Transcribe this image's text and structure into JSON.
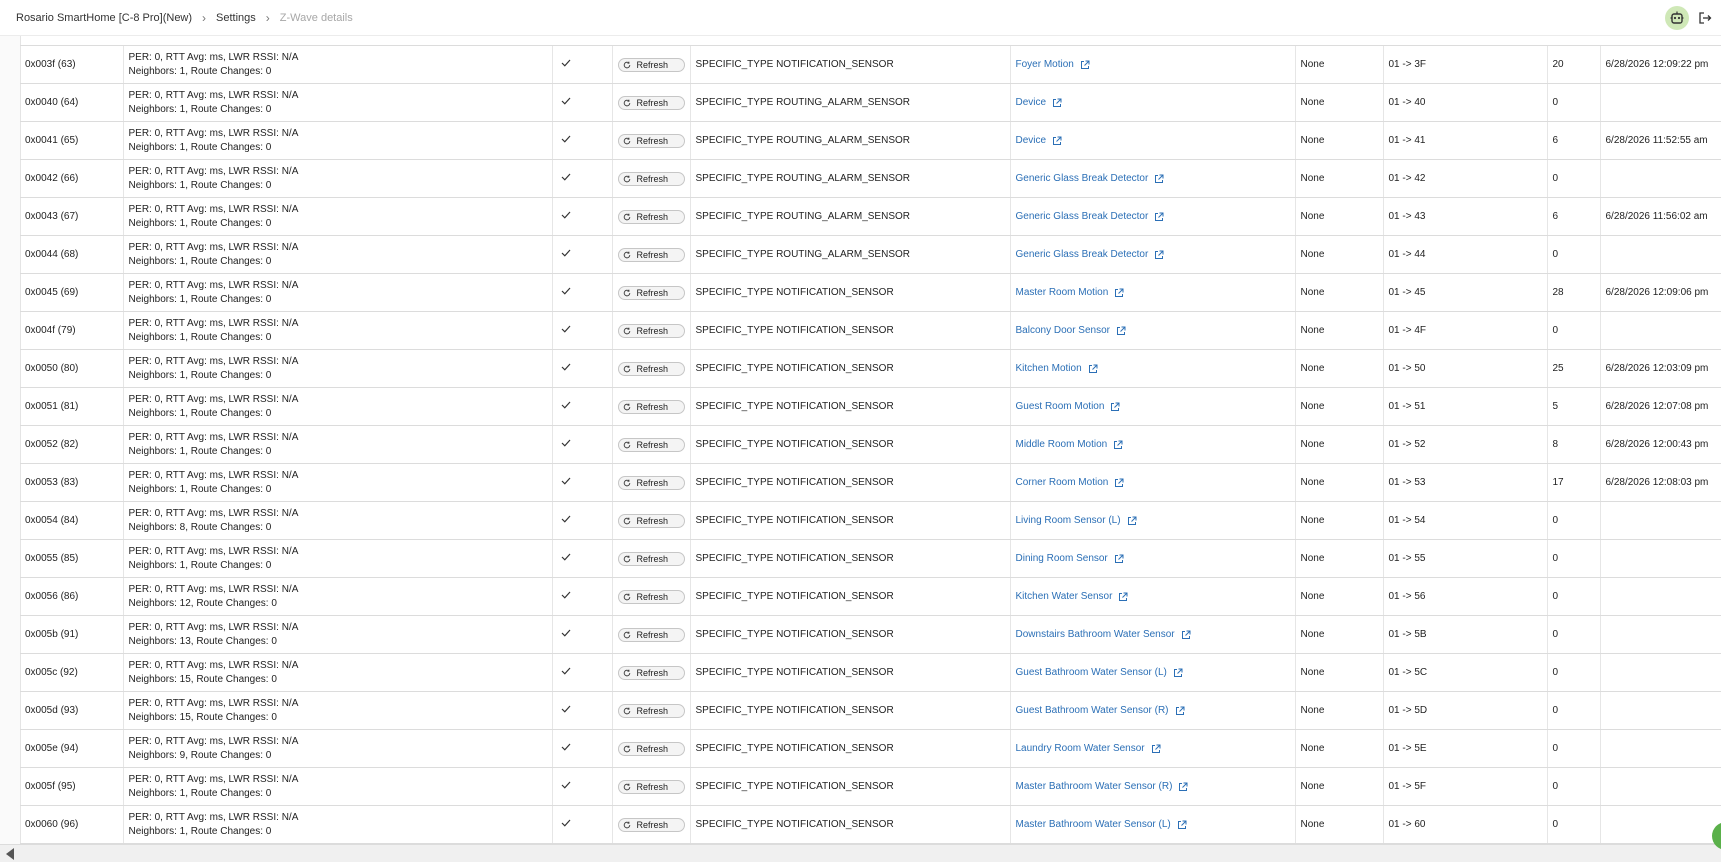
{
  "breadcrumb": {
    "hub": "Rosario SmartHome [C-8 Pro](New)",
    "settings": "Settings",
    "current": "Z-Wave details"
  },
  "icons": {
    "robot": "robot-icon",
    "logout": "logout-icon",
    "refresh": "refresh-icon",
    "external": "external-link-icon",
    "check": "check-icon"
  },
  "colors": {
    "link": "#2b6fb6",
    "robot_bg": "#cfe8b7",
    "fab": "#5ab04a"
  },
  "refresh_label": "Refresh",
  "rows": [
    {
      "id": "0x003f (63)",
      "stats": "PER: 0, RTT Avg: ms, LWR RSSI: N/A",
      "neighbors": "Neighbors: 1, Route Changes: 0",
      "type": "SPECIFIC_TYPE NOTIFICATION_SENSOR",
      "device": "Foyer Motion",
      "security": "None",
      "route": "01 -> 3F",
      "count": "20",
      "time": "6/28/2026 12:09:22 pm"
    },
    {
      "id": "0x0040 (64)",
      "stats": "PER: 0, RTT Avg: ms, LWR RSSI: N/A",
      "neighbors": "Neighbors: 1, Route Changes: 0",
      "type": "SPECIFIC_TYPE ROUTING_ALARM_SENSOR",
      "device": "Device",
      "security": "None",
      "route": "01 -> 40",
      "count": "0",
      "time": ""
    },
    {
      "id": "0x0041 (65)",
      "stats": "PER: 0, RTT Avg: ms, LWR RSSI: N/A",
      "neighbors": "Neighbors: 1, Route Changes: 0",
      "type": "SPECIFIC_TYPE ROUTING_ALARM_SENSOR",
      "device": "Device",
      "security": "None",
      "route": "01 -> 41",
      "count": "6",
      "time": "6/28/2026 11:52:55 am"
    },
    {
      "id": "0x0042 (66)",
      "stats": "PER: 0, RTT Avg: ms, LWR RSSI: N/A",
      "neighbors": "Neighbors: 1, Route Changes: 0",
      "type": "SPECIFIC_TYPE ROUTING_ALARM_SENSOR",
      "device": "Generic Glass Break Detector",
      "security": "None",
      "route": "01 -> 42",
      "count": "0",
      "time": ""
    },
    {
      "id": "0x0043 (67)",
      "stats": "PER: 0, RTT Avg: ms, LWR RSSI: N/A",
      "neighbors": "Neighbors: 1, Route Changes: 0",
      "type": "SPECIFIC_TYPE ROUTING_ALARM_SENSOR",
      "device": "Generic Glass Break Detector",
      "security": "None",
      "route": "01 -> 43",
      "count": "6",
      "time": "6/28/2026 11:56:02 am"
    },
    {
      "id": "0x0044 (68)",
      "stats": "PER: 0, RTT Avg: ms, LWR RSSI: N/A",
      "neighbors": "Neighbors: 1, Route Changes: 0",
      "type": "SPECIFIC_TYPE ROUTING_ALARM_SENSOR",
      "device": "Generic Glass Break Detector",
      "security": "None",
      "route": "01 -> 44",
      "count": "0",
      "time": ""
    },
    {
      "id": "0x0045 (69)",
      "stats": "PER: 0, RTT Avg: ms, LWR RSSI: N/A",
      "neighbors": "Neighbors: 1, Route Changes: 0",
      "type": "SPECIFIC_TYPE NOTIFICATION_SENSOR",
      "device": "Master Room Motion",
      "security": "None",
      "route": "01 -> 45",
      "count": "28",
      "time": "6/28/2026 12:09:06 pm"
    },
    {
      "id": "0x004f (79)",
      "stats": "PER: 0, RTT Avg: ms, LWR RSSI: N/A",
      "neighbors": "Neighbors: 1, Route Changes: 0",
      "type": "SPECIFIC_TYPE NOTIFICATION_SENSOR",
      "device": "Balcony Door Sensor",
      "security": "None",
      "route": "01 -> 4F",
      "count": "0",
      "time": ""
    },
    {
      "id": "0x0050 (80)",
      "stats": "PER: 0, RTT Avg: ms, LWR RSSI: N/A",
      "neighbors": "Neighbors: 1, Route Changes: 0",
      "type": "SPECIFIC_TYPE NOTIFICATION_SENSOR",
      "device": "Kitchen Motion",
      "security": "None",
      "route": "01 -> 50",
      "count": "25",
      "time": "6/28/2026 12:03:09 pm"
    },
    {
      "id": "0x0051 (81)",
      "stats": "PER: 0, RTT Avg: ms, LWR RSSI: N/A",
      "neighbors": "Neighbors: 1, Route Changes: 0",
      "type": "SPECIFIC_TYPE NOTIFICATION_SENSOR",
      "device": "Guest Room Motion",
      "security": "None",
      "route": "01 -> 51",
      "count": "5",
      "time": "6/28/2026 12:07:08 pm"
    },
    {
      "id": "0x0052 (82)",
      "stats": "PER: 0, RTT Avg: ms, LWR RSSI: N/A",
      "neighbors": "Neighbors: 1, Route Changes: 0",
      "type": "SPECIFIC_TYPE NOTIFICATION_SENSOR",
      "device": "Middle Room Motion",
      "security": "None",
      "route": "01 -> 52",
      "count": "8",
      "time": "6/28/2026 12:00:43 pm"
    },
    {
      "id": "0x0053 (83)",
      "stats": "PER: 0, RTT Avg: ms, LWR RSSI: N/A",
      "neighbors": "Neighbors: 1, Route Changes: 0",
      "type": "SPECIFIC_TYPE NOTIFICATION_SENSOR",
      "device": "Corner Room Motion",
      "security": "None",
      "route": "01 -> 53",
      "count": "17",
      "time": "6/28/2026 12:08:03 pm"
    },
    {
      "id": "0x0054 (84)",
      "stats": "PER: 0, RTT Avg: ms, LWR RSSI: N/A",
      "neighbors": "Neighbors: 8, Route Changes: 0",
      "type": "SPECIFIC_TYPE NOTIFICATION_SENSOR",
      "device": "Living Room Sensor (L)",
      "security": "None",
      "route": "01 -> 54",
      "count": "0",
      "time": ""
    },
    {
      "id": "0x0055 (85)",
      "stats": "PER: 0, RTT Avg: ms, LWR RSSI: N/A",
      "neighbors": "Neighbors: 1, Route Changes: 0",
      "type": "SPECIFIC_TYPE NOTIFICATION_SENSOR",
      "device": "Dining Room Sensor",
      "security": "None",
      "route": "01 -> 55",
      "count": "0",
      "time": ""
    },
    {
      "id": "0x0056 (86)",
      "stats": "PER: 0, RTT Avg: ms, LWR RSSI: N/A",
      "neighbors": "Neighbors: 12, Route Changes: 0",
      "type": "SPECIFIC_TYPE NOTIFICATION_SENSOR",
      "device": "Kitchen Water Sensor",
      "security": "None",
      "route": "01 -> 56",
      "count": "0",
      "time": ""
    },
    {
      "id": "0x005b (91)",
      "stats": "PER: 0, RTT Avg: ms, LWR RSSI: N/A",
      "neighbors": "Neighbors: 13, Route Changes: 0",
      "type": "SPECIFIC_TYPE NOTIFICATION_SENSOR",
      "device": "Downstairs Bathroom Water Sensor",
      "security": "None",
      "route": "01 -> 5B",
      "count": "0",
      "time": ""
    },
    {
      "id": "0x005c (92)",
      "stats": "PER: 0, RTT Avg: ms, LWR RSSI: N/A",
      "neighbors": "Neighbors: 15, Route Changes: 0",
      "type": "SPECIFIC_TYPE NOTIFICATION_SENSOR",
      "device": "Guest Bathroom Water Sensor (L)",
      "security": "None",
      "route": "01 -> 5C",
      "count": "0",
      "time": ""
    },
    {
      "id": "0x005d (93)",
      "stats": "PER: 0, RTT Avg: ms, LWR RSSI: N/A",
      "neighbors": "Neighbors: 15, Route Changes: 0",
      "type": "SPECIFIC_TYPE NOTIFICATION_SENSOR",
      "device": "Guest Bathroom Water Sensor (R)",
      "security": "None",
      "route": "01 -> 5D",
      "count": "0",
      "time": ""
    },
    {
      "id": "0x005e (94)",
      "stats": "PER: 0, RTT Avg: ms, LWR RSSI: N/A",
      "neighbors": "Neighbors: 9, Route Changes: 0",
      "type": "SPECIFIC_TYPE NOTIFICATION_SENSOR",
      "device": "Laundry Room Water Sensor",
      "security": "None",
      "route": "01 -> 5E",
      "count": "0",
      "time": ""
    },
    {
      "id": "0x005f (95)",
      "stats": "PER: 0, RTT Avg: ms, LWR RSSI: N/A",
      "neighbors": "Neighbors: 1, Route Changes: 0",
      "type": "SPECIFIC_TYPE NOTIFICATION_SENSOR",
      "device": "Master Bathroom Water Sensor (R)",
      "security": "None",
      "route": "01 -> 5F",
      "count": "0",
      "time": ""
    },
    {
      "id": "0x0060 (96)",
      "stats": "PER: 0, RTT Avg: ms, LWR RSSI: N/A",
      "neighbors": "Neighbors: 1, Route Changes: 0",
      "type": "SPECIFIC_TYPE NOTIFICATION_SENSOR",
      "device": "Master Bathroom Water Sensor (L)",
      "security": "None",
      "route": "01 -> 60",
      "count": "0",
      "time": ""
    }
  ]
}
